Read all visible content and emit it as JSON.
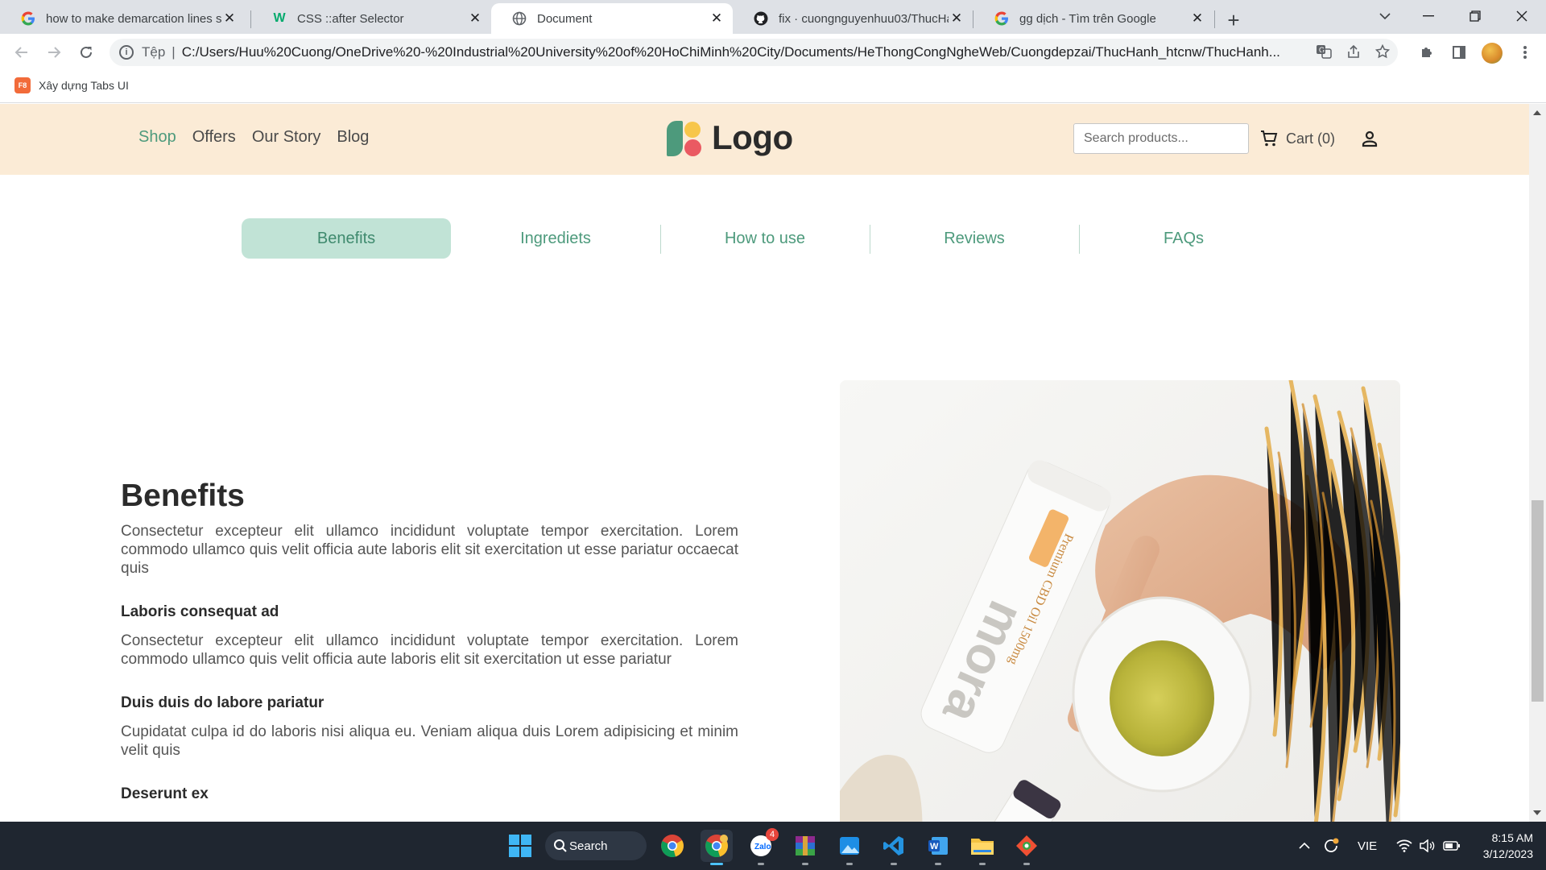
{
  "browser": {
    "tabs": [
      {
        "title": "how to make demarcation lines s",
        "icon": "google-icon",
        "active": false
      },
      {
        "title": "CSS ::after Selector",
        "icon": "w3schools-icon",
        "active": false
      },
      {
        "title": "Document",
        "icon": "globe-icon",
        "active": true
      },
      {
        "title": "fix · cuongnguyenhuu03/ThucHa",
        "icon": "github-icon",
        "active": false
      },
      {
        "title": "gg dịch - Tìm trên Google",
        "icon": "google-icon",
        "active": false
      }
    ],
    "address": {
      "scheme": "Tệp",
      "url": "C:/Users/Huu%20Cuong/OneDrive%20-%20Industrial%20University%20of%20HoChiMinh%20City/Documents/HeThongCongNgheWeb/Cuongdepzai/ThucHanh_htcnw/ThucHanh..."
    },
    "bookmarks": [
      {
        "label": "Xây dựng Tabs UI",
        "badge": "F8"
      }
    ]
  },
  "site": {
    "nav": [
      {
        "label": "Shop",
        "active": true
      },
      {
        "label": "Offers",
        "active": false
      },
      {
        "label": "Our Story",
        "active": false
      },
      {
        "label": "Blog",
        "active": false
      }
    ],
    "logo_text": "Logo",
    "search_placeholder": "Search products...",
    "cart_label": "Cart (0)",
    "product_tabs": [
      {
        "label": "Benefits",
        "active": true
      },
      {
        "label": "Ingrediets",
        "active": false
      },
      {
        "label": "How to use",
        "active": false
      },
      {
        "label": "Reviews",
        "active": false
      },
      {
        "label": "FAQs",
        "active": false
      }
    ],
    "content": {
      "heading": "Benefits",
      "intro": "Consectetur excepteur elit ullamco incididunt voluptate tempor exercitation. Lorem commodo ullamco quis velit officia aute laboris elit sit exercitation ut esse pariatur occaecat quis",
      "sections": [
        {
          "title": "Laboris consequat ad",
          "text": "Consectetur excepteur elit ullamco incididunt voluptate tempor exercitation. Lorem commodo ullamco quis velit officia aute laboris elit sit exercitation ut esse pariatur"
        },
        {
          "title": "Duis duis do labore pariatur",
          "text": "Cupidatat culpa id do laboris nisi aliqua eu. Veniam aliqua duis Lorem adipisicing et minim velit quis"
        },
        {
          "title": "Deserunt ex",
          "text": ""
        }
      ]
    },
    "photo": {
      "bottle_label": "mora",
      "bottle_text": "Premium CBD Oil 1500mg"
    }
  },
  "taskbar": {
    "search_label": "Search",
    "zalo_badge": "4",
    "language": "VIE",
    "time": "8:15 AM",
    "date": "3/12/2023"
  },
  "colors": {
    "header_bg": "#fbebd6",
    "accent_green": "#4d9a7c",
    "active_tab_bg": "#c1e3d6",
    "taskbar_bg": "#1f2630"
  }
}
